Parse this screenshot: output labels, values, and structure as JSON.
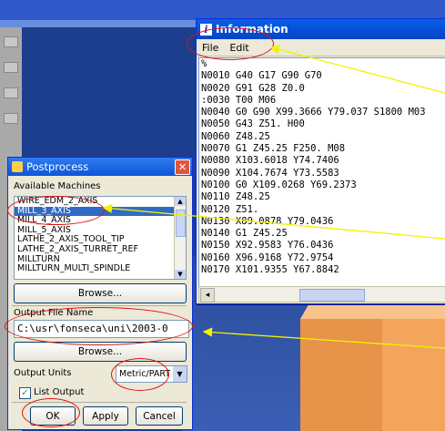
{
  "information_window": {
    "title": "Information",
    "title_icon": "i",
    "menu": [
      "File",
      "Edit"
    ],
    "lines": [
      "%",
      "N0010 G40 G17 G90 G70",
      "N0020 G91 G28 Z0.0",
      ":0030 T00 M06",
      "N0040 G0 G90 X99.3666 Y79.037 S1800 M03",
      "N0050 G43 Z51. H00",
      "N0060 Z48.25",
      "N0070 G1 Z45.25 F250. M08",
      "N0080 X103.6018 Y74.7406",
      "N0090 X104.7674 Y73.5583",
      "N0100 G0 X109.0268 Y69.2373",
      "N0110 Z48.25",
      "N0120 Z51.",
      "N0130 X89.0878 Y79.0436",
      "N0140 G1 Z45.25",
      "N0150 X92.9583 Y76.0436",
      "N0160 X96.9168 Y72.9754",
      "N0170 X101.9355 Y67.8842"
    ]
  },
  "postprocess_dialog": {
    "title": "Postprocess",
    "close_glyph": "✕",
    "available_machines_label": "Available Machines",
    "machines": [
      "WIRE_EDM_2_AXIS",
      "MILL_3_AXIS",
      "MILL_4_AXIS",
      "MILL_5_AXIS",
      "LATHE_2_AXIS_TOOL_TIP",
      "LATHE_2_AXIS_TURRET_REF",
      "MILLTURN",
      "MILLTURN_MULTI_SPINDLE"
    ],
    "selected_machine_index": 1,
    "browse_label": "Browse...",
    "output_file_label": "Output File Name",
    "output_file_value": "C:\\usr\\fonseca\\uni\\2003-0",
    "browse2_label": "Browse...",
    "output_units_label": "Output Units",
    "output_units_value": "Metric/PART",
    "list_output_label": "List Output",
    "list_output_checked": true,
    "ok_label": "OK",
    "apply_label": "Apply",
    "cancel_label": "Cancel"
  },
  "colors": {
    "annotation_red": "#e01010",
    "annotation_arrow": "#f2f200",
    "selection_blue": "#316ac5"
  }
}
